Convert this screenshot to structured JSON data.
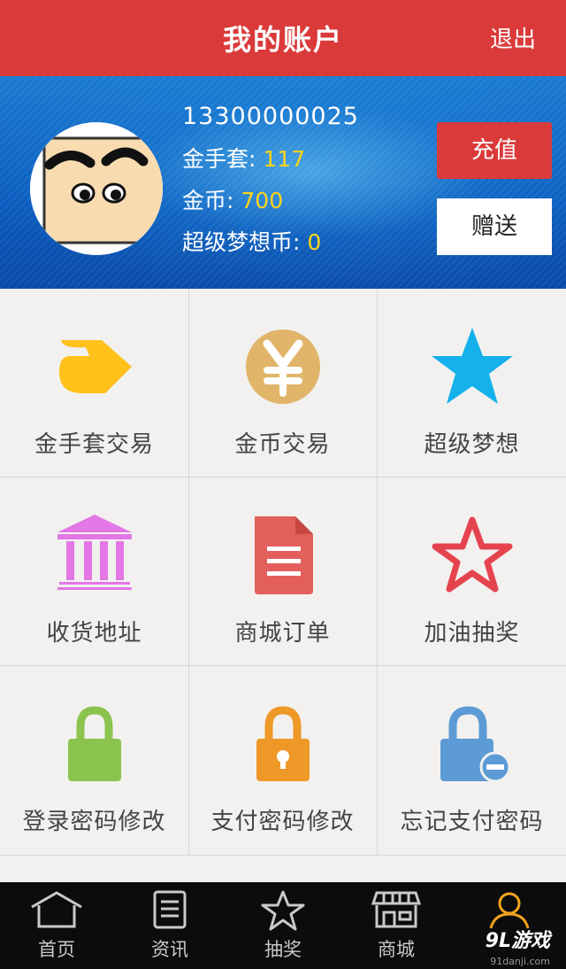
{
  "header": {
    "title": "我的账户",
    "logout": "退出"
  },
  "profile": {
    "phone": "13300000025",
    "gloves_label": "金手套:",
    "gloves_value": "117",
    "coins_label": "金币:",
    "coins_value": "700",
    "super_label": "超级梦想币:",
    "super_value": "0",
    "charge_button": "充值",
    "gift_button": "赠送"
  },
  "menu": [
    {
      "label": "金手套交易",
      "icon": "glove-icon",
      "color": "#ffc11a"
    },
    {
      "label": "金币交易",
      "icon": "yen-coin-icon",
      "color": "#e0b56a"
    },
    {
      "label": "超级梦想",
      "icon": "star-filled-icon",
      "color": "#15b1ec"
    },
    {
      "label": "收货地址",
      "icon": "bank-building-icon",
      "color": "#e277e5"
    },
    {
      "label": "商城订单",
      "icon": "document-icon",
      "color": "#e25f5b"
    },
    {
      "label": "加油抽奖",
      "icon": "star-outline-icon",
      "color": "#e5444f"
    },
    {
      "label": "登录密码修改",
      "icon": "lock-icon",
      "color": "#8bc34f"
    },
    {
      "label": "支付密码修改",
      "icon": "keyhole-lock-icon",
      "color": "#ee9828"
    },
    {
      "label": "忘记支付密码",
      "icon": "lock-minus-icon",
      "color": "#5c9bd6"
    }
  ],
  "tabs": [
    {
      "label": "首页",
      "icon": "home-icon"
    },
    {
      "label": "资讯",
      "icon": "news-icon"
    },
    {
      "label": "抽奖",
      "icon": "star-icon"
    },
    {
      "label": "商城",
      "icon": "shop-icon"
    },
    {
      "label": "",
      "icon": "user-icon",
      "active": true
    }
  ],
  "watermark": {
    "brand": "9L游戏",
    "url": "91danji.com"
  }
}
